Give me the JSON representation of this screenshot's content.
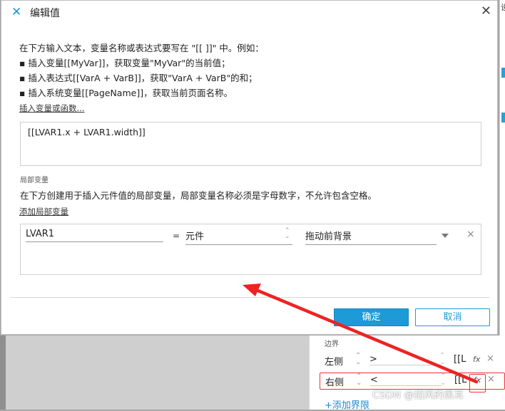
{
  "background": {
    "edge_caption": "设",
    "section_label": "边界",
    "rows": [
      {
        "label": "左侧",
        "operator": ">",
        "value": "[[L",
        "fx": "fx",
        "delete": "×"
      },
      {
        "label": "右侧",
        "operator": "<",
        "value": "[[L",
        "fx": "fx",
        "delete": "×"
      }
    ],
    "add_boundary": "+添加界限",
    "watermark": "CSDN @招风的黑耳"
  },
  "dialog": {
    "title": "编辑值",
    "close_icon": "close-icon",
    "instructions": [
      "在下方输入文本，变量名称或表达式要写在 \"[[ ]]\" 中。例如：",
      "▪ 插入变量[[MyVar]]，获取变量\"MyVar\"的当前值；",
      "▪ 插入表达式[[VarA + VarB]]，获取\"VarA + VarB\"的和；",
      "▪ 插入系统变量[[PageName]]，获取当前页面名称。"
    ],
    "insert_link": "插入变量或函数...",
    "expression": "[[LVAR1.x + LVAR1.width]]",
    "local_vars_label": "局部变量",
    "local_vars_desc": "在下方创建用于插入元件值的局部变量，局部变量名称必须是字母数字，不允许包含空格。",
    "add_local_var": "添加局部变量",
    "local_var": {
      "name": "LVAR1",
      "equals": "=",
      "type": "元件",
      "target": "拖动前背景",
      "delete": "×"
    },
    "ok_label": "确定",
    "cancel_label": "取消"
  },
  "colors": {
    "accent": "#1e9ad6",
    "highlight": "#e33333"
  }
}
